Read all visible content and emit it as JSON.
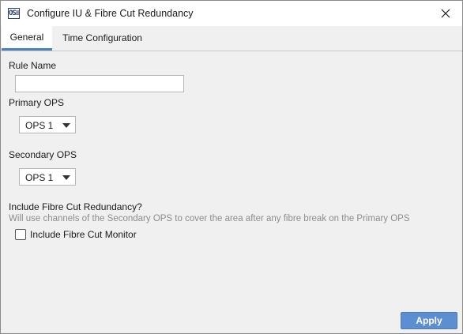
{
  "window": {
    "title": "Configure IU & Fibre Cut Redundancy",
    "icon_text": "OS≡",
    "icon_name": "app-logo-icon"
  },
  "tabs": [
    {
      "label": "General",
      "active": true
    },
    {
      "label": "Time Configuration",
      "active": false
    }
  ],
  "form": {
    "rule_name_label": "Rule Name",
    "rule_name_value": "",
    "primary_ops_label": "Primary OPS",
    "primary_ops_value": "OPS 1",
    "secondary_ops_label": "Secondary OPS",
    "secondary_ops_value": "OPS 1",
    "fibre_cut_heading": "Include Fibre Cut Redundancy?",
    "fibre_cut_hint": "Will use channels of the Secondary OPS to cover the area after any fibre break on the Primary OPS",
    "include_monitor_label": "Include Fibre Cut Monitor",
    "include_monitor_checked": false
  },
  "actions": {
    "apply_label": "Apply"
  },
  "colors": {
    "accent": "#4a7fc0",
    "apply_button": "#5b8fd1",
    "hint_text": "#8c8c8c",
    "window_bg": "#f0f0f0"
  }
}
